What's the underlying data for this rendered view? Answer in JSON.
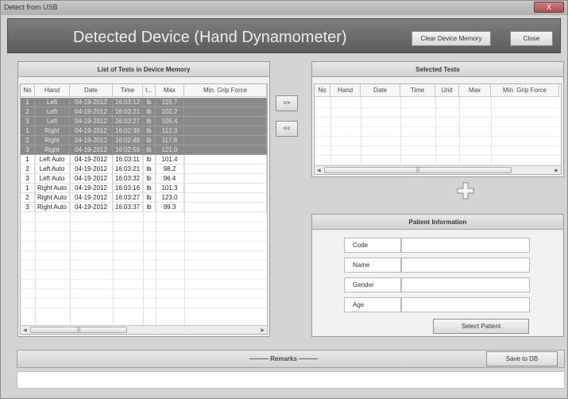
{
  "window": {
    "title": "Detect from USB",
    "close_label": "X"
  },
  "header": {
    "title": "Detected Device (Hand Dynamometer)",
    "clear_button": "Clear Device Memory",
    "close_button": "Close"
  },
  "tests_panel": {
    "title": "List of Tests in Device Memory",
    "columns": [
      "No",
      "Hand",
      "Date",
      "Time",
      "I...",
      "Max",
      "Min. Grip Force"
    ],
    "rows": [
      {
        "no": "1",
        "hand": "Left",
        "date": "04-19-2012",
        "time": "16:03:12",
        "unit": "lb",
        "max": "115.7",
        "min": "",
        "selected": true
      },
      {
        "no": "2",
        "hand": "Left",
        "date": "04-19-2012",
        "time": "16:03:21",
        "unit": "lb",
        "max": "102.2",
        "min": "",
        "selected": true
      },
      {
        "no": "3",
        "hand": "Left",
        "date": "04-19-2012",
        "time": "16:03:27",
        "unit": "lb",
        "max": "105.4",
        "min": "",
        "selected": true
      },
      {
        "no": "1",
        "hand": "Right",
        "date": "04-19-2012",
        "time": "16:02:39",
        "unit": "lb",
        "max": "112.3",
        "min": "",
        "selected": true
      },
      {
        "no": "2",
        "hand": "Right",
        "date": "04-19-2012",
        "time": "16:02:48",
        "unit": "lb",
        "max": "117.8",
        "min": "",
        "selected": true
      },
      {
        "no": "3",
        "hand": "Right",
        "date": "04-19-2012",
        "time": "16:02:59",
        "unit": "lb",
        "max": "121.0",
        "min": "",
        "selected": true
      },
      {
        "no": "1",
        "hand": "Left Auto",
        "date": "04-19-2012",
        "time": "16:03:11",
        "unit": "lb",
        "max": "101.4",
        "min": "",
        "selected": false
      },
      {
        "no": "2",
        "hand": "Left Auto",
        "date": "04-19-2012",
        "time": "16:03:21",
        "unit": "lb",
        "max": "98.2",
        "min": "",
        "selected": false
      },
      {
        "no": "3",
        "hand": "Left Auto",
        "date": "04-19-2012",
        "time": "16:03:32",
        "unit": "lb",
        "max": "96.4",
        "min": "",
        "selected": false
      },
      {
        "no": "1",
        "hand": "Right Auto",
        "date": "04-19-2012",
        "time": "16:03:16",
        "unit": "lb",
        "max": "101.3",
        "min": "",
        "selected": false
      },
      {
        "no": "2",
        "hand": "Right Auto",
        "date": "04-19-2012",
        "time": "16:03:27",
        "unit": "lb",
        "max": "123.0",
        "min": "",
        "selected": false
      },
      {
        "no": "3",
        "hand": "Right Auto",
        "date": "04-19-2012",
        "time": "16:03:37",
        "unit": "lb",
        "max": "99.3",
        "min": "",
        "selected": false
      }
    ]
  },
  "transfer": {
    "add": ">>",
    "remove": "<<"
  },
  "selected_panel": {
    "title": "Selected Tests",
    "columns": [
      "No",
      "Hand",
      "Date",
      "Time",
      "Unit",
      "Max",
      "Min. Grip Force"
    ]
  },
  "patient_panel": {
    "title": "Patient Information",
    "fields": [
      {
        "label": "Code",
        "value": ""
      },
      {
        "label": "Name",
        "value": ""
      },
      {
        "label": "Gender",
        "value": ""
      },
      {
        "label": "Age",
        "value": ""
      }
    ],
    "select_button": "Select Patient"
  },
  "remarks": {
    "label": "——— Remarks ———",
    "save_button": "Save to DB",
    "text": ""
  },
  "colors": {
    "header_bg": "#6a6a6a",
    "selected_row": "#8a8a8a"
  },
  "icons": {
    "plus": "plus-icon"
  }
}
